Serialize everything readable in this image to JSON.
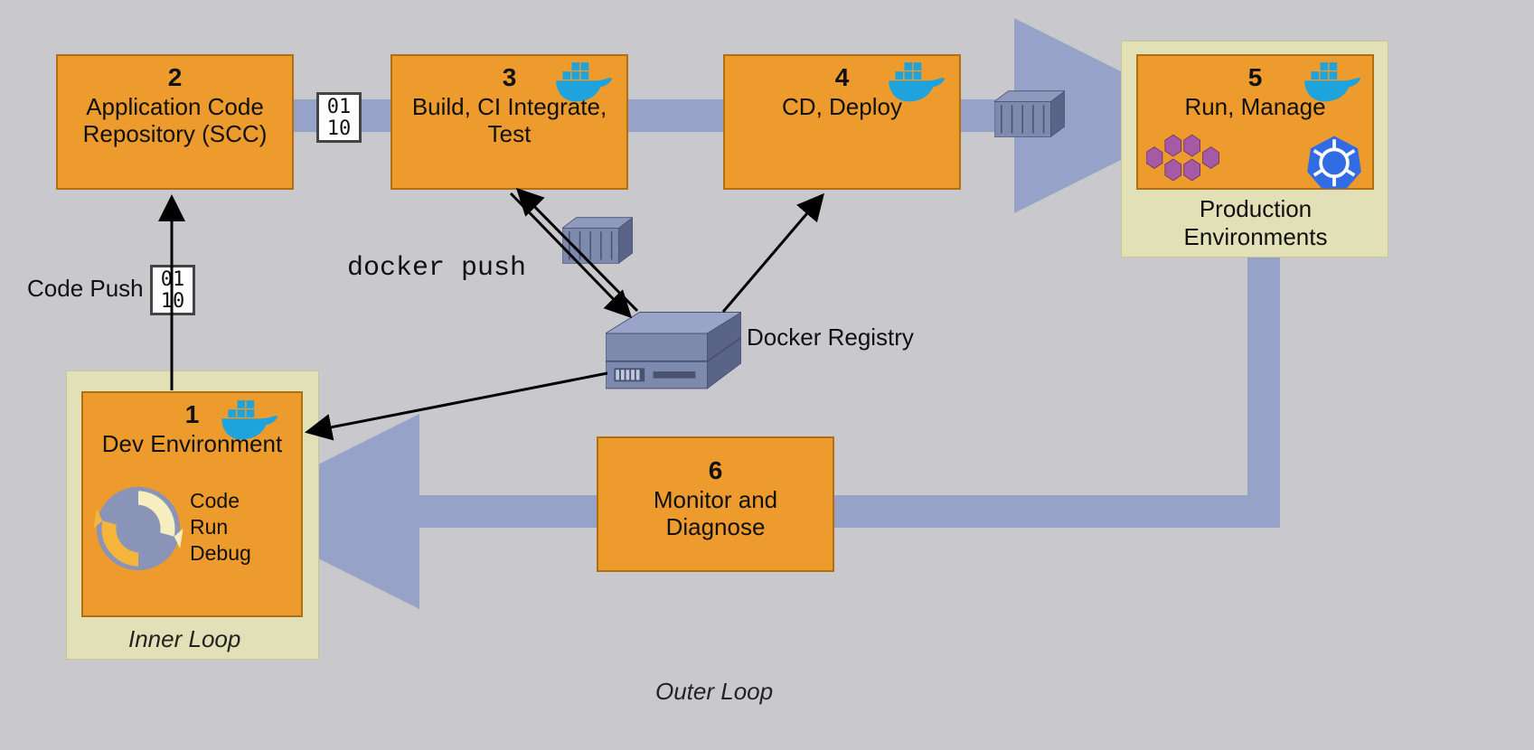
{
  "stages": {
    "s1": {
      "num": "1",
      "title": "Dev Environment",
      "cycle": {
        "a": "Code",
        "b": "Run",
        "c": "Debug"
      }
    },
    "s2": {
      "num": "2",
      "title": "Application Code Repository (SCC)"
    },
    "s3": {
      "num": "3",
      "title": "Build, CI Integrate, Test"
    },
    "s4": {
      "num": "4",
      "title": "CD, Deploy"
    },
    "s5": {
      "num": "5",
      "title": "Run, Manage"
    },
    "s6": {
      "num": "6",
      "title": "Monitor and Diagnose"
    }
  },
  "labels": {
    "inner_loop": "Inner Loop",
    "outer_loop": "Outer Loop",
    "code_push": "Code Push",
    "docker_push": "docker push",
    "docker_registry": "Docker Registry",
    "prod_env": "Production Environments",
    "binary1": "01",
    "binary2": "10"
  },
  "colors": {
    "flow_arrow": "#97a2c8",
    "stage_fill": "#ed9b2c",
    "env_fill": "#e2e0b7",
    "container": "#6a769a",
    "docker_blue": "#1ea3dd",
    "kube_blue": "#326ce5"
  }
}
